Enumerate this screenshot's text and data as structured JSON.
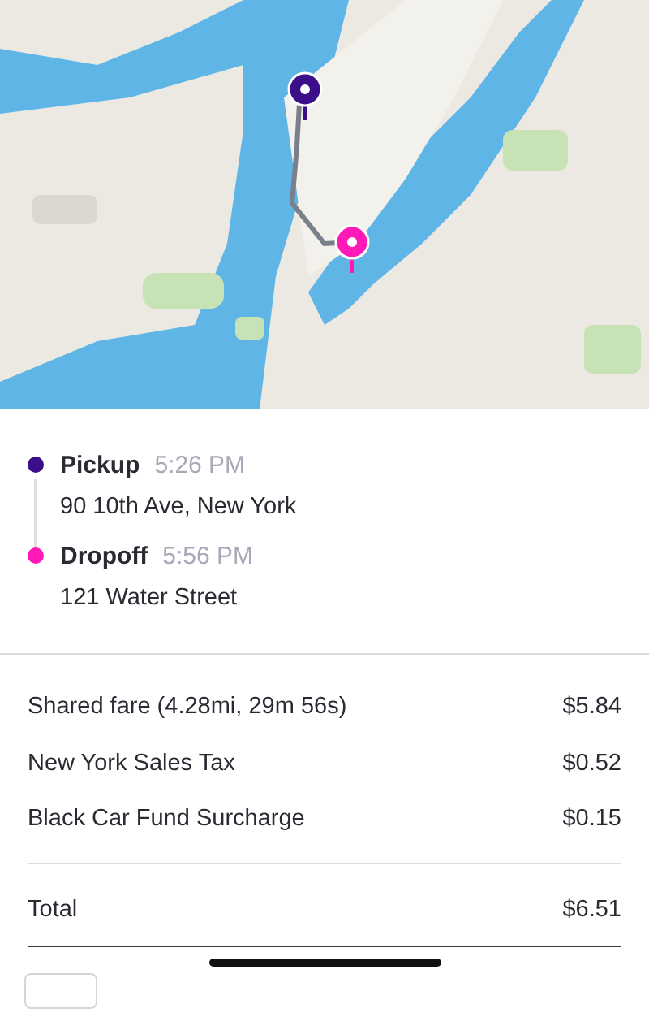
{
  "stops": [
    {
      "label": "Pickup",
      "time": "5:26 PM",
      "address": "90 10th Ave, New York",
      "color": "#3b0f8a"
    },
    {
      "label": "Dropoff",
      "time": "5:56 PM",
      "address": "121 Water Street",
      "color": "#ff1ab8"
    }
  ],
  "fare_items": [
    {
      "label": "Shared fare (4.28mi, 29m 56s)",
      "amount": "$5.84"
    },
    {
      "label": "New York Sales Tax",
      "amount": "$0.52"
    },
    {
      "label": "Black Car Fund Surcharge",
      "amount": "$0.15"
    }
  ],
  "total": {
    "label": "Total",
    "amount": "$6.51"
  }
}
